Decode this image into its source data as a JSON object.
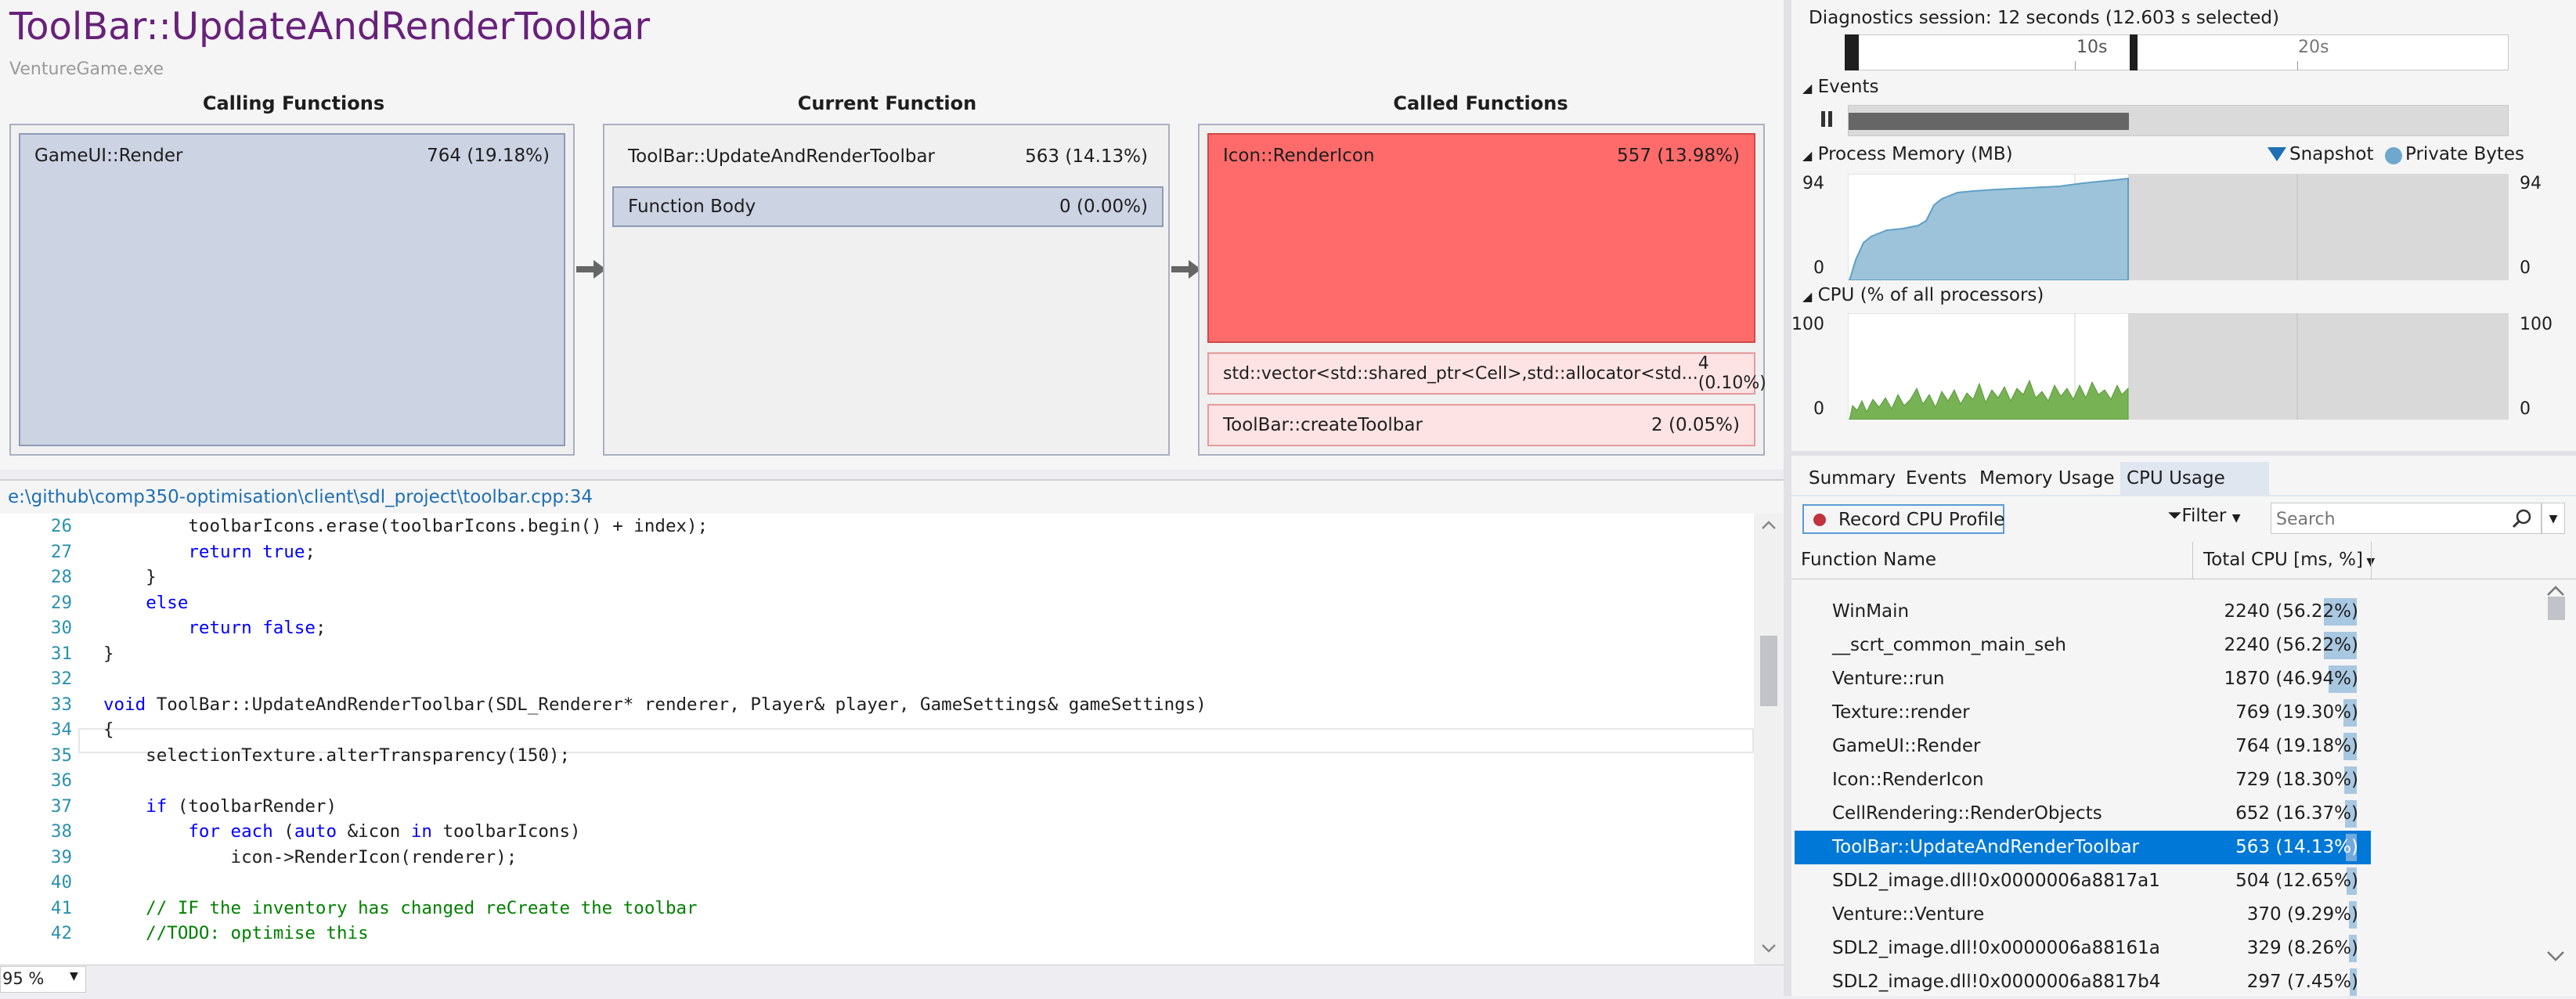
{
  "header": {
    "title": "ToolBar::UpdateAndRenderToolbar",
    "process": "VentureGame.exe"
  },
  "columns": {
    "calling": "Calling Functions",
    "current": "Current Function",
    "called": "Called Functions"
  },
  "calling_functions": [
    {
      "name": "GameUI::Render",
      "value": "764 (19.18%)"
    }
  ],
  "current_function": {
    "name": "ToolBar::UpdateAndRenderToolbar",
    "value": "563 (14.13%)",
    "body_name": "Function Body",
    "body_value": "0 (0.00%)"
  },
  "called_functions": [
    {
      "name": "Icon::RenderIcon",
      "value": "557 (13.98%)"
    },
    {
      "name": "std::vector<std::shared_ptr<Cell>,std::allocator<std...",
      "value": "4 (0.10%)"
    },
    {
      "name": "ToolBar::createToolbar",
      "value": "2 (0.05%)"
    }
  ],
  "file_path": "e:\\github\\comp350-optimisation\\client\\sdl_project\\toolbar.cpp:34",
  "code_lines": [
    {
      "n": "26",
      "segments": [
        {
          "t": "        toolbarIcons.erase(toolbarIcons.begin() + index);",
          "c": ""
        }
      ]
    },
    {
      "n": "27",
      "segments": [
        {
          "t": "        ",
          "c": ""
        },
        {
          "t": "return",
          "c": "kw"
        },
        {
          "t": " ",
          "c": ""
        },
        {
          "t": "true",
          "c": "kw"
        },
        {
          "t": ";",
          "c": ""
        }
      ]
    },
    {
      "n": "28",
      "segments": [
        {
          "t": "    }",
          "c": ""
        }
      ]
    },
    {
      "n": "29",
      "segments": [
        {
          "t": "    ",
          "c": ""
        },
        {
          "t": "else",
          "c": "kw"
        }
      ]
    },
    {
      "n": "30",
      "segments": [
        {
          "t": "        ",
          "c": ""
        },
        {
          "t": "return",
          "c": "kw"
        },
        {
          "t": " ",
          "c": ""
        },
        {
          "t": "false",
          "c": "kw"
        },
        {
          "t": ";",
          "c": ""
        }
      ]
    },
    {
      "n": "31",
      "segments": [
        {
          "t": "}",
          "c": ""
        }
      ]
    },
    {
      "n": "32",
      "segments": [
        {
          "t": "",
          "c": ""
        }
      ]
    },
    {
      "n": "33",
      "segments": [
        {
          "t": "void",
          "c": "kw"
        },
        {
          "t": " ToolBar::UpdateAndRenderToolbar(SDL_Renderer* renderer, Player& player, GameSettings& gameSettings)",
          "c": ""
        }
      ]
    },
    {
      "n": "34",
      "segments": [
        {
          "t": "{",
          "c": ""
        }
      ]
    },
    {
      "n": "35",
      "segments": [
        {
          "t": "    selectionTexture.alterTransparency(150);",
          "c": ""
        }
      ]
    },
    {
      "n": "36",
      "segments": [
        {
          "t": "",
          "c": ""
        }
      ]
    },
    {
      "n": "37",
      "segments": [
        {
          "t": "    ",
          "c": ""
        },
        {
          "t": "if",
          "c": "kw"
        },
        {
          "t": " (toolbarRender)",
          "c": ""
        }
      ]
    },
    {
      "n": "38",
      "segments": [
        {
          "t": "        ",
          "c": ""
        },
        {
          "t": "for each",
          "c": "kw"
        },
        {
          "t": " (",
          "c": ""
        },
        {
          "t": "auto",
          "c": "kw"
        },
        {
          "t": " &icon ",
          "c": ""
        },
        {
          "t": "in",
          "c": "kw"
        },
        {
          "t": " toolbarIcons)",
          "c": ""
        }
      ]
    },
    {
      "n": "39",
      "segments": [
        {
          "t": "            icon->RenderIcon(renderer);",
          "c": ""
        }
      ]
    },
    {
      "n": "40",
      "segments": [
        {
          "t": "",
          "c": ""
        }
      ]
    },
    {
      "n": "41",
      "segments": [
        {
          "t": "    // IF the inventory has changed reCreate the toolbar",
          "c": "cm"
        }
      ]
    },
    {
      "n": "42",
      "segments": [
        {
          "t": "    //TODO: optimise this",
          "c": "cm"
        }
      ]
    }
  ],
  "zoom": "95 %",
  "diagnostics": {
    "session": "Diagnostics session: 12 seconds (12.603 s selected)",
    "ruler_ticks": [
      "10s",
      "20s"
    ],
    "events_label": "Events",
    "memory_label": "Process Memory (MB)",
    "memory_legend": [
      "Snapshot",
      "Private Bytes"
    ],
    "memory_max": "94",
    "memory_min": "0",
    "cpu_label": "CPU (% of all processors)",
    "cpu_max": "100",
    "cpu_min": "0"
  },
  "tabs": [
    "Summary",
    "Events",
    "Memory Usage",
    "CPU Usage"
  ],
  "record_button": "Record CPU Profile",
  "filter_label": "Filter",
  "search_placeholder": "Search",
  "table": {
    "col_name": "Function Name",
    "col_total": "Total CPU [ms, %]",
    "rows": [
      {
        "name": "WinMain",
        "value": "2240 (56.22%)",
        "pct": 56.22
      },
      {
        "name": "__scrt_common_main_seh",
        "value": "2240 (56.22%)",
        "pct": 56.22
      },
      {
        "name": "Venture::run",
        "value": "1870 (46.94%)",
        "pct": 46.94
      },
      {
        "name": "Texture::render",
        "value": "769 (19.30%)",
        "pct": 19.3
      },
      {
        "name": "GameUI::Render",
        "value": "764 (19.18%)",
        "pct": 19.18
      },
      {
        "name": "Icon::RenderIcon",
        "value": "729 (18.30%)",
        "pct": 18.3
      },
      {
        "name": "CellRendering::RenderObjects",
        "value": "652 (16.37%)",
        "pct": 16.37
      },
      {
        "name": "ToolBar::UpdateAndRenderToolbar",
        "value": "563 (14.13%)",
        "pct": 14.13,
        "selected": true
      },
      {
        "name": "SDL2_image.dll!0x0000006a8817a1",
        "value": "504 (12.65%)",
        "pct": 12.65
      },
      {
        "name": "Venture::Venture",
        "value": "370 (9.29%)",
        "pct": 9.29
      },
      {
        "name": "SDL2_image.dll!0x0000006a88161a",
        "value": "329 (8.26%)",
        "pct": 8.26
      },
      {
        "name": "SDL2_image.dll!0x0000006a8817b4",
        "value": "297 (7.45%)",
        "pct": 7.45
      }
    ]
  },
  "colors": {
    "title": "#68217a",
    "calling_box": "#ccd3e3",
    "called_hot": "#ff6b6b",
    "called_light": "#fde3e3",
    "memory_fill": "#9cc3da",
    "cpu_fill": "#77b255",
    "selection": "#0078d7"
  }
}
